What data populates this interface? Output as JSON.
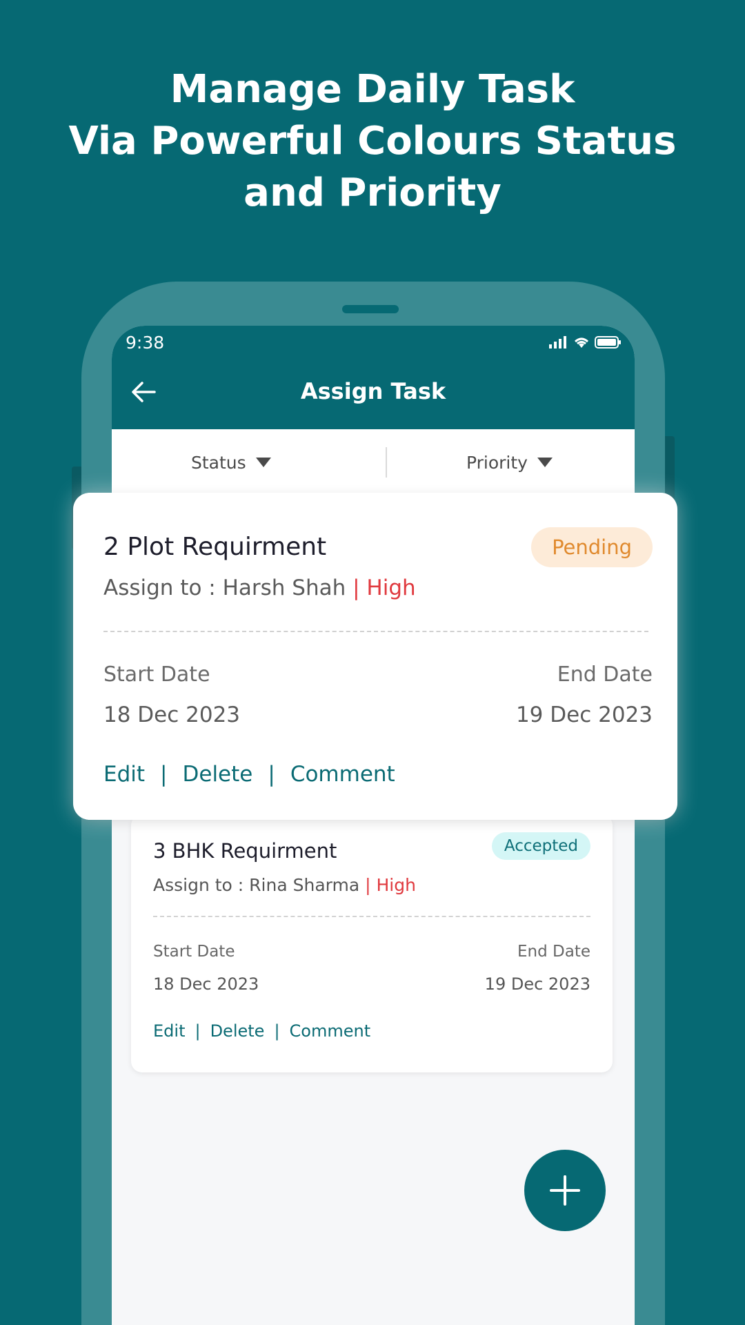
{
  "headline": {
    "line1": "Manage Daily Task",
    "line2": "Via Powerful Colours Status",
    "line3": "and Priority"
  },
  "phone": {
    "status_time": "9:38",
    "icons": [
      "signal-icon",
      "wifi-icon",
      "battery-icon"
    ]
  },
  "appbar": {
    "title": "Assign Task",
    "back_icon": "arrow-left-icon"
  },
  "filters": {
    "status_label": "Status",
    "priority_label": "Priority"
  },
  "tasks": [
    {
      "title": "2 Plot Requirment",
      "status": "Pending",
      "assign_prefix": "Assign to : Harsh Shah",
      "priority": "| High",
      "start_label": "Start Date",
      "end_label": "End Date",
      "start_date": "18 Dec 2023",
      "end_date": "19 Dec 2023",
      "edit": "Edit",
      "delete": "Delete",
      "comment": "Comment",
      "sep": "|"
    },
    {
      "title": "3 BHK Requirment",
      "status": "Accepted",
      "assign_prefix": "Assign to : Rina Sharma",
      "priority": "| High",
      "start_label": "Start Date",
      "end_label": "End Date",
      "start_date": "18 Dec 2023",
      "end_date": "19 Dec 2023",
      "edit": "Edit",
      "delete": "Delete",
      "comment": "Comment",
      "sep": "|"
    }
  ],
  "colors": {
    "brand": "#066973",
    "pending_bg": "#fdebd8",
    "pending_text": "#e08a2e",
    "accepted_bg": "#d4f6f6",
    "accepted_text": "#0e6f78",
    "high": "#e0393e"
  },
  "fab_icon": "plus-icon"
}
